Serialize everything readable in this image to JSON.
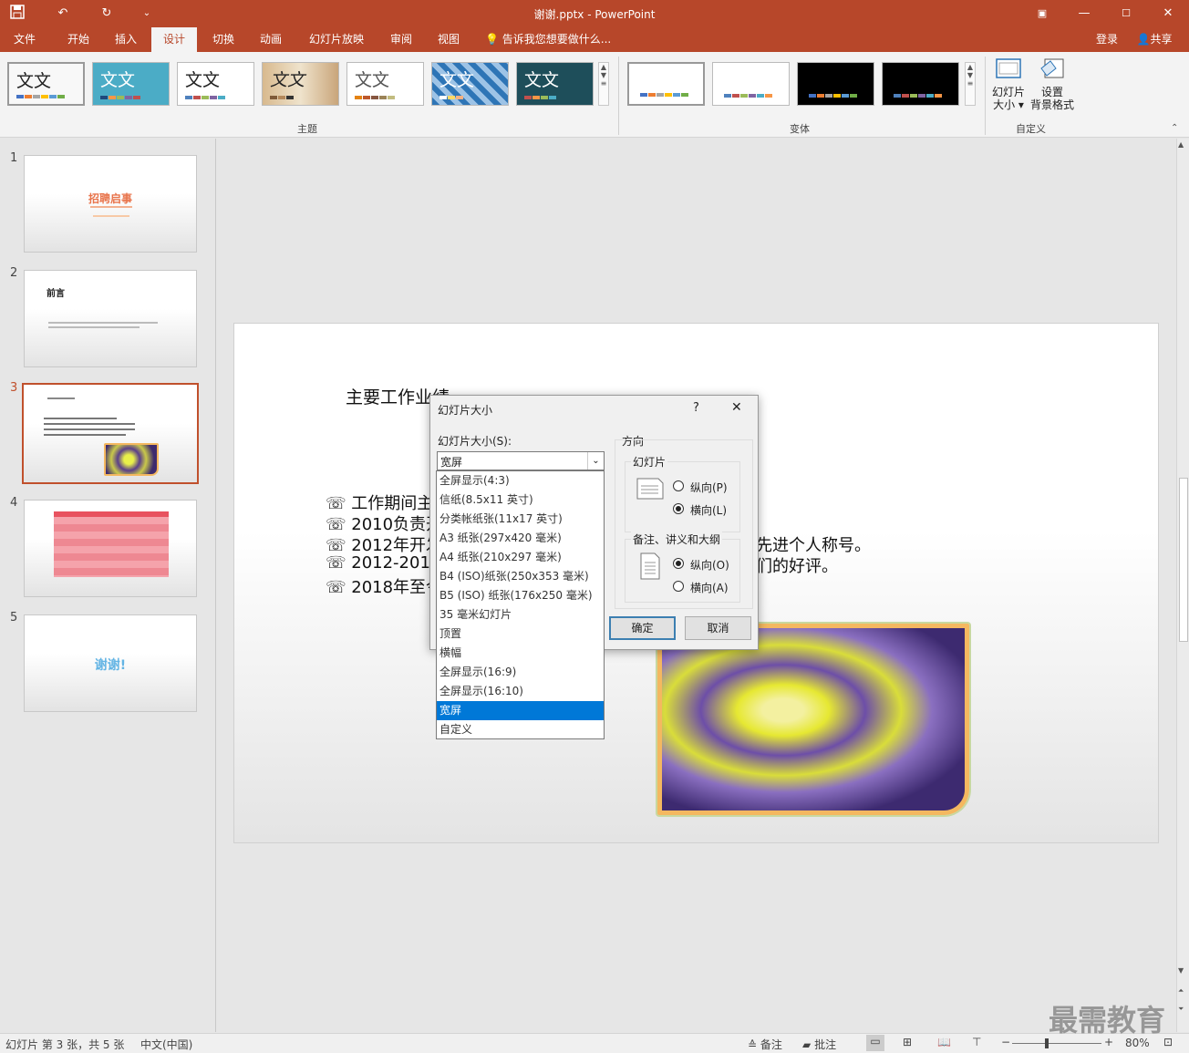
{
  "window": {
    "title": "谢谢.pptx - PowerPoint"
  },
  "tabs": [
    "文件",
    "开始",
    "插入",
    "设计",
    "切换",
    "动画",
    "幻灯片放映",
    "审阅",
    "视图"
  ],
  "tell_me": "告诉我您想要做什么...",
  "account": {
    "signin": "登录",
    "share": "共享"
  },
  "ribbon": {
    "themes_label": "主题",
    "variants_label": "变体",
    "customize_label": "自定义",
    "theme_text": "文文",
    "slide_size_button": {
      "line1": "幻灯片",
      "line2": "大小"
    },
    "format_bg_button": {
      "line1": "设置",
      "line2": "背景格式"
    }
  },
  "thumbnails": {
    "numbers": [
      "1",
      "2",
      "3",
      "4",
      "5"
    ],
    "slide1_title": "招聘启事",
    "slide2_title": "前言",
    "slide5_title": "谢谢!"
  },
  "slide": {
    "heading": "主要工作业绩",
    "bullets": [
      "工作期间主",
      "2010负责开",
      "2012年开发",
      "2012-2018",
      "2018年至今"
    ],
    "bullet_tail_3": "先进个人称号。",
    "bullet_tail_4": "们的好评。",
    "bullet_icon": "☏"
  },
  "dialog": {
    "title": "幻灯片大小",
    "help": "?",
    "close": "✕",
    "size_label": "幻灯片大小(S):",
    "size_value": "宽屏",
    "orientation_label": "方向",
    "slides_group": "幻灯片",
    "portrait": "纵向(P)",
    "landscape": "横向(L)",
    "notes_group": "备注、讲义和大纲",
    "notes_portrait": "纵向(O)",
    "notes_landscape": "横向(A)",
    "ok": "确定",
    "cancel": "取消",
    "options": [
      "全屏显示(4:3)",
      "信纸(8.5x11 英寸)",
      "分类帐纸张(11x17 英寸)",
      "A3 纸张(297x420 毫米)",
      "A4 纸张(210x297 毫米)",
      "B4 (ISO)纸张(250x353 毫米)",
      "B5 (ISO) 纸张(176x250 毫米)",
      "35 毫米幻灯片",
      "顶置",
      "横幅",
      "全屏显示(16:9)",
      "全屏显示(16:10)",
      "宽屏",
      "自定义"
    ]
  },
  "status": {
    "slide_info": "幻灯片 第 3 张，共 5 张",
    "language": "中文(中国)",
    "notes": "备注",
    "comments": "批注",
    "zoom": "80%"
  },
  "watermark": "最需教育",
  "colors": {
    "accent": "#b7472a",
    "highlight": "#0078d7"
  }
}
